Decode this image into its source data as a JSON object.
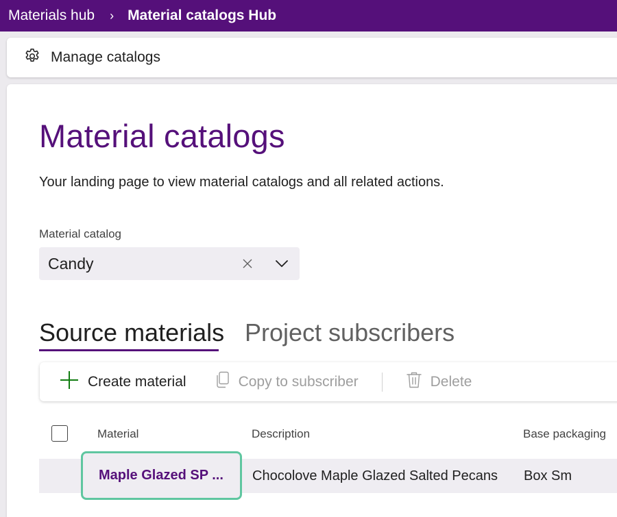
{
  "breadcrumb": {
    "parent": "Materials hub",
    "separator": "›",
    "current": "Material catalogs Hub"
  },
  "commandbar": {
    "manage_label": "Manage catalogs",
    "manage_icon": "gear-icon"
  },
  "page": {
    "title": "Material catalogs",
    "subtitle": "Your landing page to view material catalogs and all related actions."
  },
  "catalog_field": {
    "label": "Material catalog",
    "value": "Candy"
  },
  "tabs": [
    {
      "label": "Source materials",
      "selected": true
    },
    {
      "label": "Project subscribers",
      "selected": false
    }
  ],
  "toolbar": {
    "create_label": "Create material",
    "copy_label": "Copy to subscriber",
    "delete_label": "Delete"
  },
  "grid": {
    "columns": [
      "Material",
      "Description",
      "Base packaging"
    ],
    "rows": [
      {
        "material": "Maple Glazed SP ...",
        "description": "Chocolove Maple Glazed Salted Pecans",
        "base_packaging": "Box Sm"
      }
    ]
  },
  "colors": {
    "brand": "#55107a",
    "create_icon": "#107c10",
    "highlight": "#5fc6a0"
  }
}
